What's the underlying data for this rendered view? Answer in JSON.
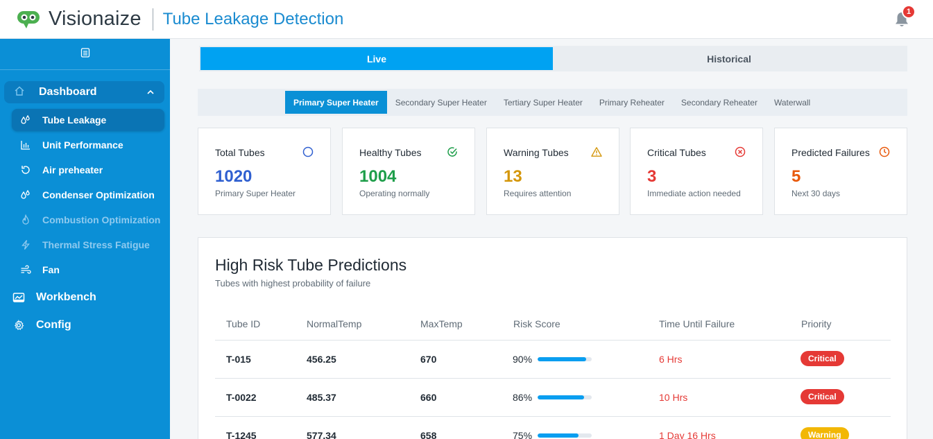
{
  "header": {
    "brand": "Visionaize",
    "app_title": "Tube Leakage Detection",
    "notification_count": "1"
  },
  "sidebar": {
    "section": {
      "label": "Dashboard",
      "icon": "home-icon"
    },
    "items": [
      {
        "label": "Tube Leakage",
        "icon": "droplets-icon",
        "active": true
      },
      {
        "label": "Unit Performance",
        "icon": "bar-chart-icon"
      },
      {
        "label": "Air preheater",
        "icon": "refresh-icon"
      },
      {
        "label": "Condenser Optimization",
        "icon": "droplets-icon"
      },
      {
        "label": "Combustion Optimization",
        "icon": "flame-icon",
        "disabled": true
      },
      {
        "label": "Thermal Stress Fatigue",
        "icon": "bolt-icon",
        "disabled": true
      },
      {
        "label": "Fan",
        "icon": "wind-icon"
      }
    ],
    "workbench": "Workbench",
    "config": "Config"
  },
  "mode_tabs": {
    "live": "Live",
    "historical": "Historical",
    "active": "live"
  },
  "sub_tabs": [
    "Primary Super Heater",
    "Secondary Super Heater",
    "Tertiary Super Heater",
    "Primary Reheater",
    "Secondary Reheater",
    "Waterwall"
  ],
  "cards": [
    {
      "title": "Total Tubes",
      "value": "1020",
      "sub": "Primary Super Heater",
      "color": "#2f5fd0",
      "icon": "circle-icon"
    },
    {
      "title": "Healthy Tubes",
      "value": "1004",
      "sub": "Operating normally",
      "color": "#1e9e4a",
      "icon": "check-circle-icon"
    },
    {
      "title": "Warning Tubes",
      "value": "13",
      "sub": "Requires attention",
      "color": "#d4960a",
      "icon": "warning-triangle-icon"
    },
    {
      "title": "Critical Tubes",
      "value": "3",
      "sub": "Immediate action needed",
      "color": "#e53935",
      "icon": "x-circle-icon"
    },
    {
      "title": "Predicted Failures",
      "value": "5",
      "sub": "Next 30 days",
      "color": "#e8590c",
      "icon": "clock-icon"
    }
  ],
  "risk_table": {
    "title": "High Risk Tube Predictions",
    "subtitle": "Tubes with highest probability of failure",
    "columns": [
      "Tube ID",
      "NormalTemp",
      "MaxTemp",
      "Risk Score",
      "Time Until Failure",
      "Priority"
    ],
    "rows": [
      {
        "id": "T-015",
        "normal": "456.25",
        "max": "670",
        "risk": "90%",
        "risk_value": 90,
        "ttf": "6 Hrs",
        "priority": "Critical"
      },
      {
        "id": "T-0022",
        "normal": "485.37",
        "max": "660",
        "risk": "86%",
        "risk_value": 86,
        "ttf": "10 Hrs",
        "priority": "Critical"
      },
      {
        "id": "T-1245",
        "normal": "577.34",
        "max": "658",
        "risk": "75%",
        "risk_value": 75,
        "ttf": "1 Day 16 Hrs",
        "priority": "Warning"
      }
    ]
  },
  "colors": {
    "accent": "#00a2f2",
    "sidebar": "#0b8fd6",
    "critical": "#e53935",
    "warning": "#f2b705"
  }
}
